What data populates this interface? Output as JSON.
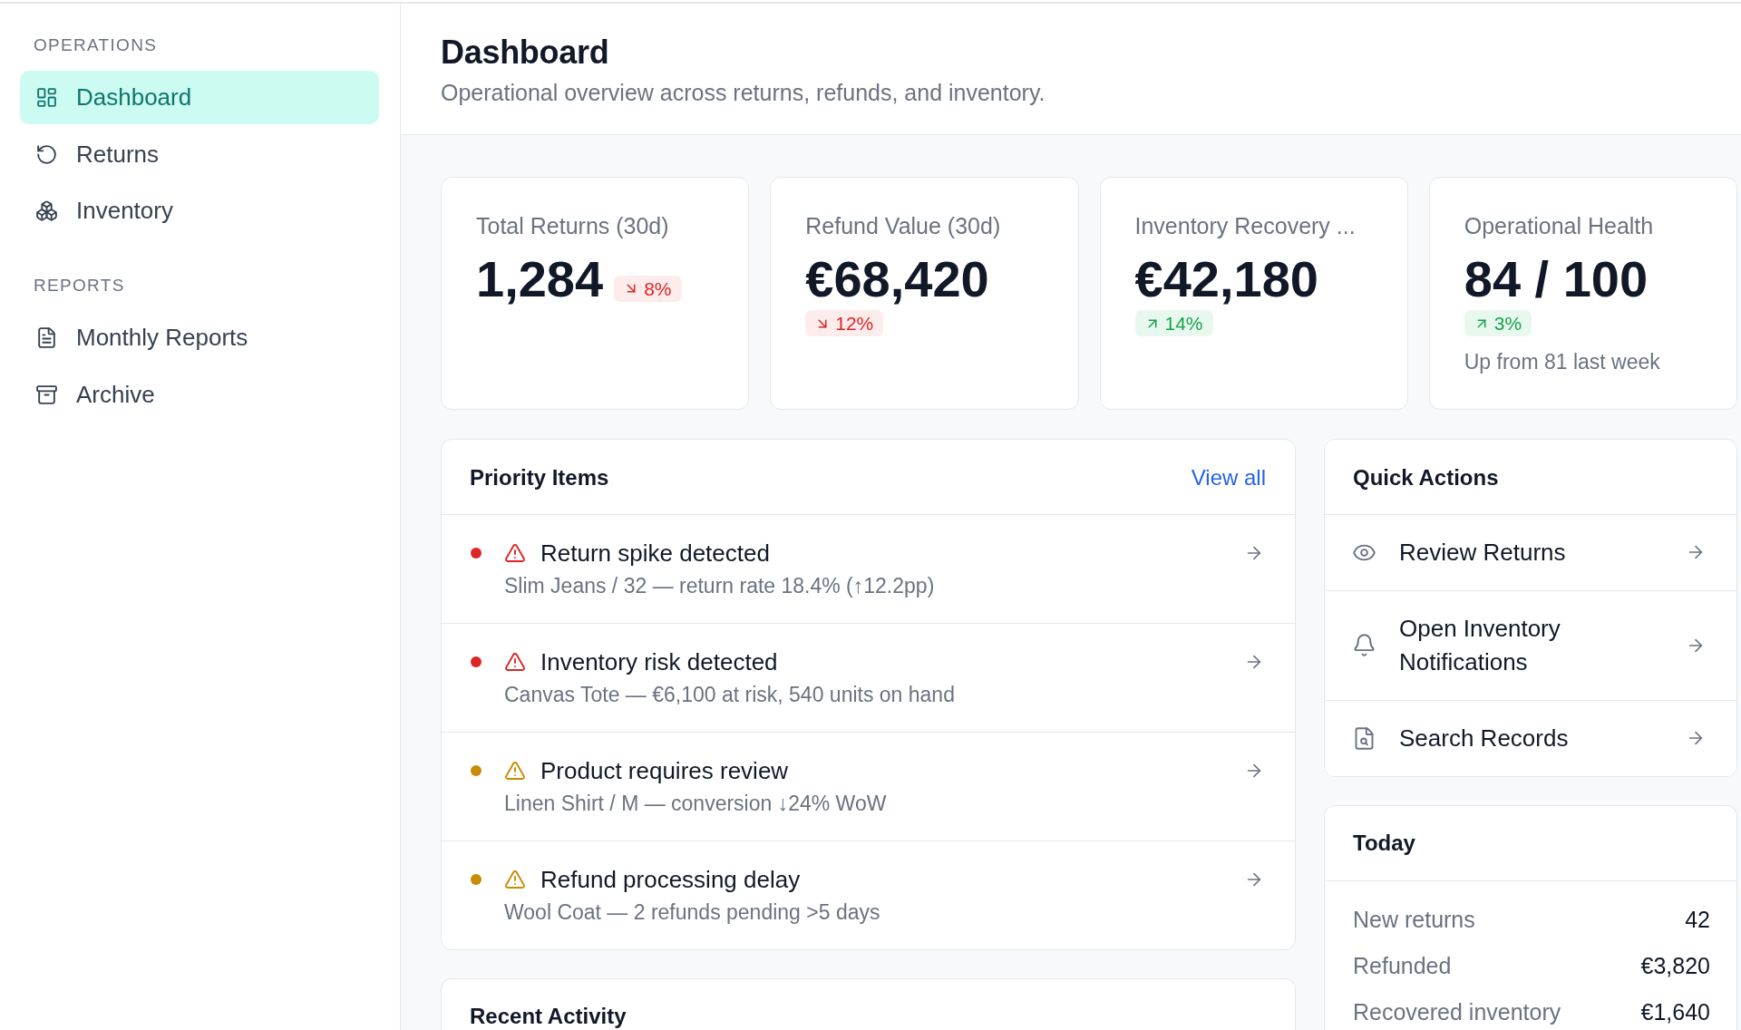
{
  "sidebar": {
    "sections": [
      {
        "heading": "OPERATIONS",
        "items": [
          {
            "label": "Dashboard",
            "selected": true
          },
          {
            "label": "Returns",
            "selected": false
          },
          {
            "label": "Inventory",
            "selected": false
          }
        ]
      },
      {
        "heading": "REPORTS",
        "items": [
          {
            "label": "Monthly Reports",
            "selected": false
          },
          {
            "label": "Archive",
            "selected": false
          }
        ]
      }
    ]
  },
  "header": {
    "title": "Dashboard",
    "subtitle": "Operational overview across returns, refunds, and inventory."
  },
  "stats": [
    {
      "label": "Total Returns (30d)",
      "value": "1,284",
      "change": {
        "rising": false,
        "text": "8%"
      }
    },
    {
      "label": "Refund Value (30d)",
      "value": "€68,420",
      "change": {
        "rising": false,
        "text": "12%"
      }
    },
    {
      "label": "Inventory Recovery ...",
      "value": "€42,180",
      "change": {
        "rising": true,
        "text": "14%"
      }
    },
    {
      "label": "Operational Health",
      "value": "84 / 100",
      "change": {
        "rising": true,
        "text": "3%"
      },
      "note": "Up from 81 last week"
    }
  ],
  "priority_items": {
    "title": "Priority Items",
    "link": "View all",
    "items": [
      {
        "title": "Return spike detected",
        "detail": "Slim Jeans / 32 — return rate 18.4% (↑12.2pp)",
        "color": "#dc2626"
      },
      {
        "title": "Inventory risk detected",
        "detail": "Canvas Tote — €6,100 at risk, 540 units on hand",
        "color": "#dc2626"
      },
      {
        "title": "Product requires review",
        "detail": "Linen Shirt / M — conversion ↓24% WoW",
        "color": "#ca8a04"
      },
      {
        "title": "Refund processing delay",
        "detail": "Wool Coat — 2 refunds pending >5 days",
        "color": "#ca8a04"
      }
    ]
  },
  "quick_actions": {
    "title": "Quick Actions",
    "items": [
      {
        "label": "Review Returns"
      },
      {
        "label": "Open Inventory Notifications"
      },
      {
        "label": "Search Records"
      }
    ]
  },
  "today": {
    "title": "Today",
    "rows": [
      {
        "label": "New returns",
        "value": "42"
      },
      {
        "label": "Refunded",
        "value": "€3,820"
      },
      {
        "label": "Recovered inventory",
        "value": "€1,640"
      }
    ]
  },
  "recent_activity": {
    "title": "Recent Activity"
  }
}
